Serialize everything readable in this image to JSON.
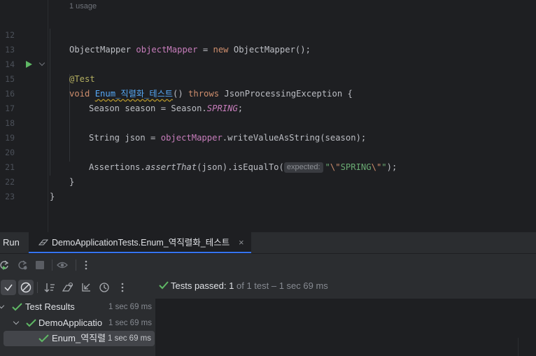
{
  "editor": {
    "usage_hint": "1 usage",
    "line_numbers": [
      "12",
      "13",
      "14",
      "15",
      "16",
      "17",
      "18",
      "19",
      "20",
      "21",
      "22",
      "23"
    ],
    "line12": {
      "type": "ObjectMapper",
      "field": "objectMapper",
      "eq": "=",
      "kw_new": "new",
      "ctor": "ObjectMapper();"
    },
    "line14": {
      "annotation": "@Test"
    },
    "line15": {
      "kw_void": "void",
      "method": "Enum_직렬화_테스트",
      "parens": "()",
      "kw_throws": "throws",
      "exception": "JsonProcessingException {"
    },
    "line16": {
      "decl": "Season season = Season.",
      "constant": "SPRING",
      "end": ";"
    },
    "line18": {
      "decl": "String json = ",
      "field": "objectMapper",
      "call": ".writeValueAsString(season);"
    },
    "line20": {
      "cls": "Assertions.",
      "method": "assertThat",
      "mid": "(json).isEqualTo(",
      "hint": "expected:",
      "q1": "\"",
      "esc1": "\\\"",
      "strval": "SPRING",
      "esc2": "\\\"",
      "q2": "\"",
      "end": ");"
    },
    "line21": {
      "brace": "}"
    },
    "line22": {
      "brace": "}"
    }
  },
  "run_panel": {
    "title": "Run",
    "tab_label": "DemoApplicationTests.Enum_역직렬화_테스트",
    "tab_close": "×",
    "status": {
      "label": "Tests passed:",
      "passed": "1",
      "of_total": "of 1 test",
      "dash": "–",
      "time": "1 sec 69 ms"
    },
    "tree": [
      {
        "label": "Test Results",
        "time": "1 sec 69 ms"
      },
      {
        "label": "DemoApplicatio",
        "time": "1 sec 69 ms"
      },
      {
        "label": "Enum_역직렬",
        "time": "1 sec 69 ms"
      }
    ],
    "toolbar_icons": [
      "rerun-icon",
      "rerun-failed-icon",
      "stop-icon",
      "eye-icon",
      "more-icon"
    ],
    "filter_icons": [
      "show-passed-icon",
      "show-ignored-icon",
      "sort-icon",
      "collapse-icon",
      "import-icon",
      "history-icon",
      "more-icon"
    ]
  },
  "colors": {
    "accent": "#3574f0",
    "success": "#5fb865",
    "keyword": "#cf8e6d",
    "field": "#c77dbb",
    "string": "#6aab73",
    "function": "#56a8f5"
  }
}
